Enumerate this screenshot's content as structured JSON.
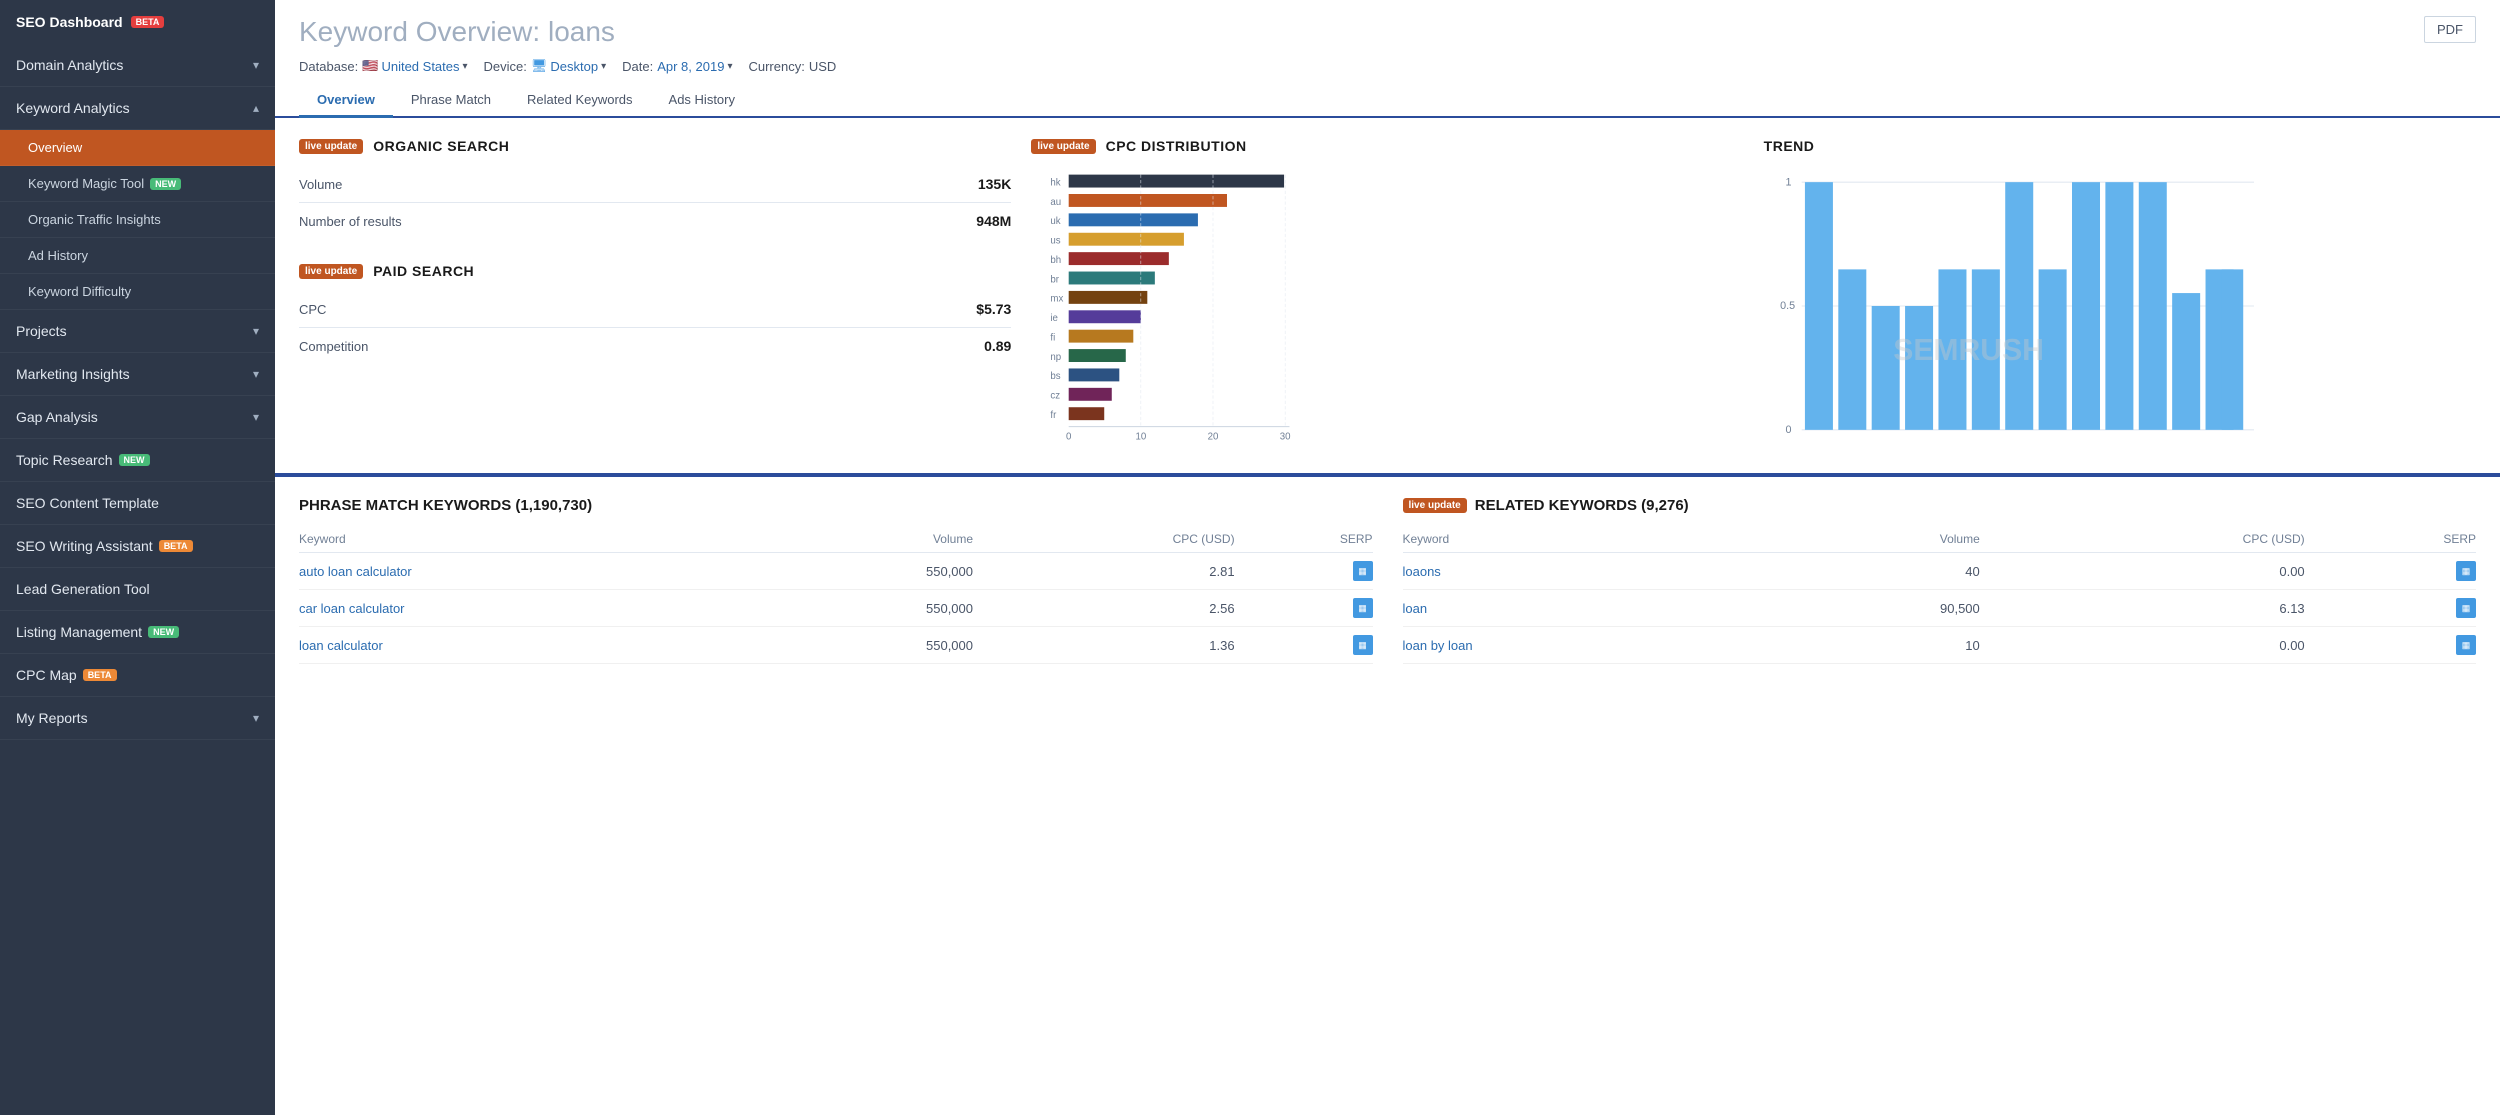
{
  "sidebar": {
    "logo": "SEO Dashboard",
    "logo_badge": "BETA",
    "items": [
      {
        "id": "domain-analytics",
        "label": "Domain Analytics",
        "has_arrow": true,
        "active": false,
        "sub": false
      },
      {
        "id": "keyword-analytics",
        "label": "Keyword Analytics",
        "has_arrow": true,
        "active": false,
        "sub": false,
        "expanded": true
      },
      {
        "id": "overview",
        "label": "Overview",
        "has_arrow": false,
        "active": true,
        "sub": true
      },
      {
        "id": "keyword-magic-tool",
        "label": "Keyword Magic Tool",
        "has_arrow": false,
        "active": false,
        "sub": true,
        "badge": "NEW"
      },
      {
        "id": "organic-traffic-insights",
        "label": "Organic Traffic Insights",
        "has_arrow": false,
        "active": false,
        "sub": true
      },
      {
        "id": "ad-history",
        "label": "Ad History",
        "has_arrow": false,
        "active": false,
        "sub": true
      },
      {
        "id": "keyword-difficulty",
        "label": "Keyword Difficulty",
        "has_arrow": false,
        "active": false,
        "sub": true
      },
      {
        "id": "projects",
        "label": "Projects",
        "has_arrow": true,
        "active": false,
        "sub": false
      },
      {
        "id": "marketing-insights",
        "label": "Marketing Insights",
        "has_arrow": true,
        "active": false,
        "sub": false
      },
      {
        "id": "gap-analysis",
        "label": "Gap Analysis",
        "has_arrow": true,
        "active": false,
        "sub": false
      },
      {
        "id": "topic-research",
        "label": "Topic Research",
        "has_arrow": false,
        "active": false,
        "sub": false,
        "badge": "NEW"
      },
      {
        "id": "seo-content-template",
        "label": "SEO Content Template",
        "has_arrow": false,
        "active": false,
        "sub": false
      },
      {
        "id": "seo-writing-assistant",
        "label": "SEO Writing Assistant",
        "has_arrow": false,
        "active": false,
        "sub": false,
        "badge": "BETA"
      },
      {
        "id": "lead-generation-tool",
        "label": "Lead Generation Tool",
        "has_arrow": false,
        "active": false,
        "sub": false
      },
      {
        "id": "listing-management",
        "label": "Listing Management",
        "has_arrow": false,
        "active": false,
        "sub": false,
        "badge": "NEW"
      },
      {
        "id": "cpc-map",
        "label": "CPC Map",
        "has_arrow": false,
        "active": false,
        "sub": false,
        "badge": "BETA"
      },
      {
        "id": "my-reports",
        "label": "My Reports",
        "has_arrow": true,
        "active": false,
        "sub": false
      }
    ]
  },
  "header": {
    "title": "Keyword Overview:",
    "keyword": "loans",
    "pdf_label": "PDF",
    "database_label": "Database:",
    "database_value": "United States",
    "device_label": "Device:",
    "device_value": "Desktop",
    "date_label": "Date:",
    "date_value": "Apr 8, 2019",
    "currency_label": "Currency:",
    "currency_value": "USD"
  },
  "tabs": [
    {
      "id": "overview",
      "label": "Overview",
      "active": true
    },
    {
      "id": "phrase-match",
      "label": "Phrase Match",
      "active": false
    },
    {
      "id": "related-keywords",
      "label": "Related Keywords",
      "active": false
    },
    {
      "id": "ads-history",
      "label": "Ads History",
      "active": false
    }
  ],
  "organic_search": {
    "title": "ORGANIC SEARCH",
    "live_label": "live update",
    "metrics": [
      {
        "label": "Volume",
        "value": "135K"
      },
      {
        "label": "Number of results",
        "value": "948M"
      }
    ]
  },
  "paid_search": {
    "title": "PAID SEARCH",
    "live_label": "live update",
    "metrics": [
      {
        "label": "CPC",
        "value": "$5.73"
      },
      {
        "label": "Competition",
        "value": "0.89"
      }
    ]
  },
  "cpc_distribution": {
    "title": "CPC DISTRIBUTION",
    "live_label": "live update",
    "countries": [
      "hk",
      "au",
      "uk",
      "us",
      "bh",
      "br",
      "mx",
      "ie",
      "fi",
      "np",
      "bs",
      "cz",
      "fr"
    ],
    "values": [
      30,
      22,
      18,
      16,
      14,
      12,
      11,
      10,
      9,
      8,
      7,
      6,
      5
    ],
    "x_labels": [
      "0",
      "10",
      "20",
      "30"
    ]
  },
  "trend": {
    "title": "TREND",
    "y_labels": [
      "1",
      "0.5",
      "0"
    ],
    "bars": [
      1.0,
      0.65,
      0.45,
      0.45,
      0.65,
      0.65,
      1.0,
      0.65,
      1.0,
      1.0,
      1.0,
      0.55,
      0.65,
      0.65
    ]
  },
  "phrase_match": {
    "title": "PHRASE MATCH KEYWORDS (1,190,730)",
    "columns": [
      "Keyword",
      "Volume",
      "CPC (USD)",
      "SERP"
    ],
    "rows": [
      {
        "keyword": "auto loan calculator",
        "volume": "550,000",
        "cpc": "2.81"
      },
      {
        "keyword": "car loan calculator",
        "volume": "550,000",
        "cpc": "2.56"
      },
      {
        "keyword": "loan calculator",
        "volume": "550,000",
        "cpc": "1.36"
      }
    ]
  },
  "related_keywords": {
    "title": "RELATED KEYWORDS (9,276)",
    "live_label": "live update",
    "columns": [
      "Keyword",
      "Volume",
      "CPC (USD)",
      "SERP"
    ],
    "rows": [
      {
        "keyword": "loaons",
        "volume": "40",
        "cpc": "0.00"
      },
      {
        "keyword": "loan",
        "volume": "90,500",
        "cpc": "6.13"
      },
      {
        "keyword": "loan by loan",
        "volume": "10",
        "cpc": "0.00"
      }
    ]
  }
}
